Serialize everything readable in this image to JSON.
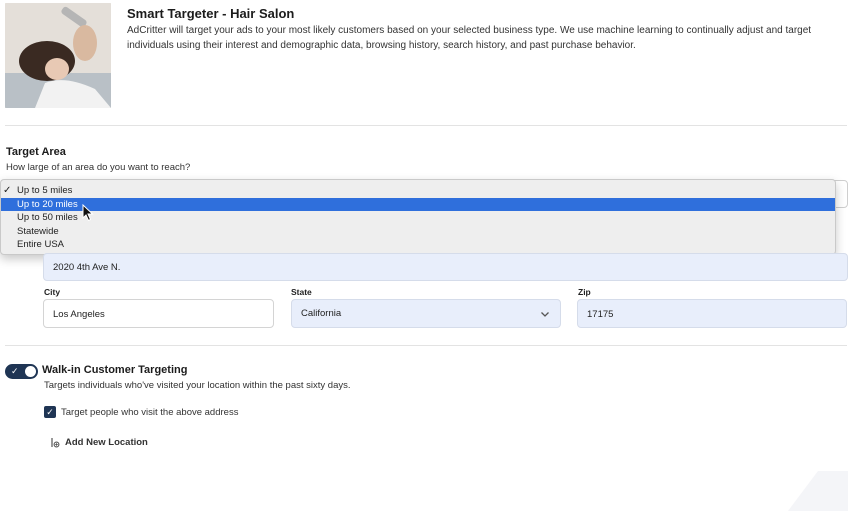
{
  "header": {
    "title": "Smart Targeter - Hair Salon",
    "description": "AdCritter will target your ads to your most likely customers based on your selected business type. We use machine learning to continually adjust and target individuals using their interest and demographic data, browsing history, search history, and past purchase behavior."
  },
  "target_area": {
    "title": "Target Area",
    "subtitle": "How large of an area do you want to reach?",
    "options": [
      {
        "label": "Up to 5 miles",
        "checked": true,
        "highlighted": false
      },
      {
        "label": "Up to 20 miles",
        "checked": false,
        "highlighted": true
      },
      {
        "label": "Up to 50 miles",
        "checked": false,
        "highlighted": false
      },
      {
        "label": "Statewide",
        "checked": false,
        "highlighted": false
      },
      {
        "label": "Entire USA",
        "checked": false,
        "highlighted": false
      }
    ],
    "check_glyph": "✓"
  },
  "address": {
    "street_value": "2020 4th Ave N.",
    "city_label": "City",
    "city_value": "Los Angeles",
    "state_label": "State",
    "state_value": "California",
    "zip_label": "Zip",
    "zip_value": "17175"
  },
  "walk_in": {
    "title": "Walk-in Customer Targeting",
    "subtitle": "Targets individuals who've visited your location within the past sixty days.",
    "enabled": true,
    "checkbox_label": "Target people who visit the above address",
    "checkbox_checked": true,
    "add_location_label": "Add New Location"
  },
  "colors": {
    "accent": "#2f6fdc",
    "dark_navy": "#1f3554",
    "field_fill": "#e8eefb"
  }
}
